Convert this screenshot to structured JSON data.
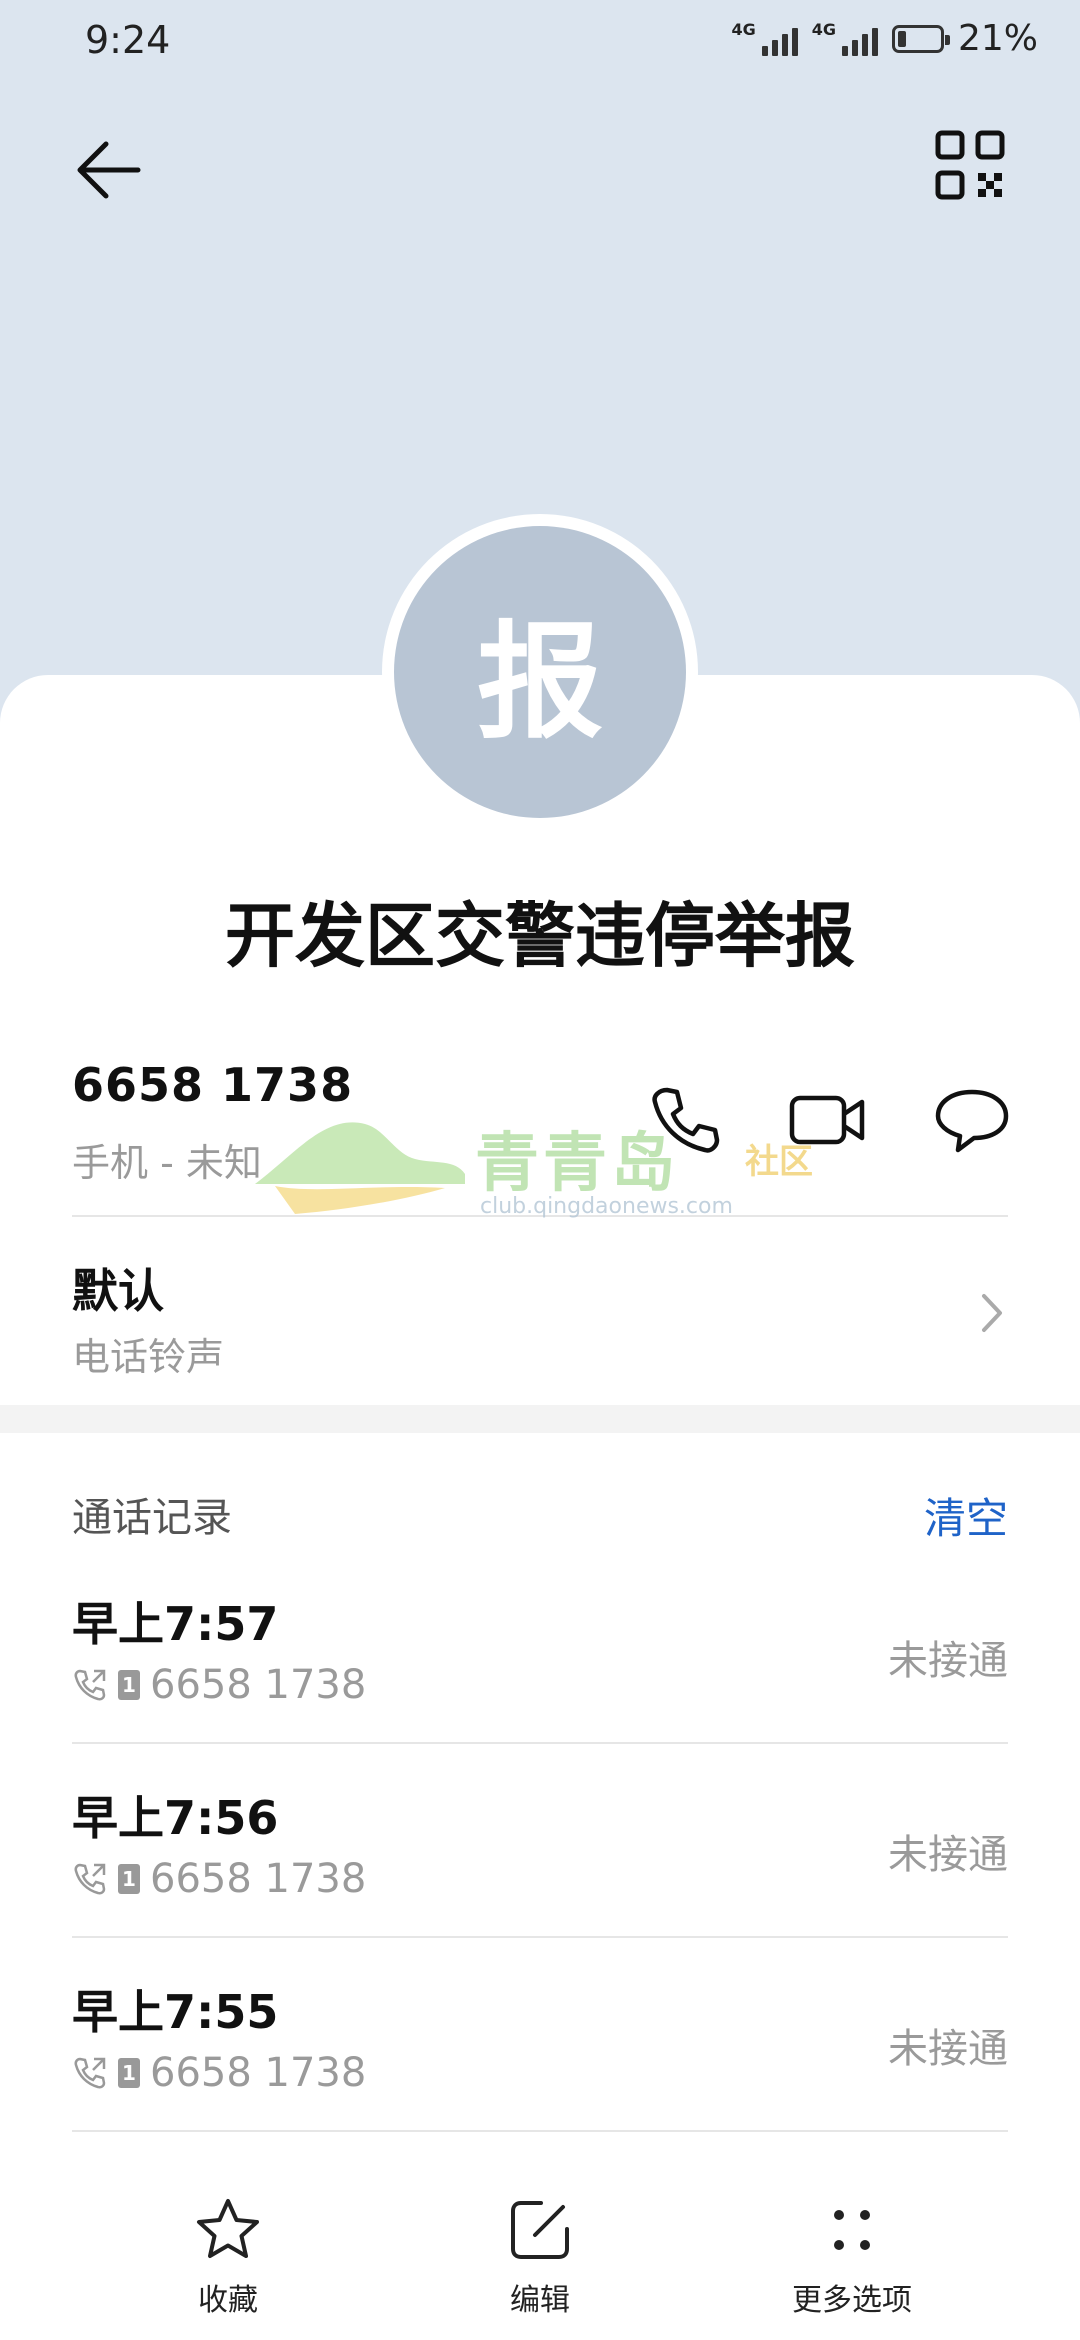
{
  "status_bar": {
    "time": "9:24",
    "network_1": "4G",
    "network_2": "4G",
    "battery": "21%",
    "battery_level": 0.21
  },
  "contact": {
    "avatar_char": "报",
    "name": "开发区交警违停举报"
  },
  "phone": {
    "number": "6658 1738",
    "type": "手机 - 未知"
  },
  "ringtone": {
    "title": "默认",
    "subtitle": "电话铃声"
  },
  "call_log": {
    "title": "通话记录",
    "clear_label": "清空",
    "entries": [
      {
        "time": "早上7:57",
        "sim": "1",
        "number": "6658 1738",
        "status": "未接通"
      },
      {
        "time": "早上7:56",
        "sim": "1",
        "number": "6658 1738",
        "status": "未接通"
      },
      {
        "time": "早上7:55",
        "sim": "1",
        "number": "6658 1738",
        "status": "未接通"
      }
    ]
  },
  "bottom_nav": {
    "favorite": "收藏",
    "edit": "编辑",
    "more": "更多选项"
  },
  "watermark": {
    "brand": "青青岛",
    "suffix": "社区",
    "url": "club.qingdaonews.com"
  },
  "colors": {
    "header_bg": "#dce5ef",
    "avatar_bg": "#b8c5d4",
    "accent": "#1f63c8"
  }
}
